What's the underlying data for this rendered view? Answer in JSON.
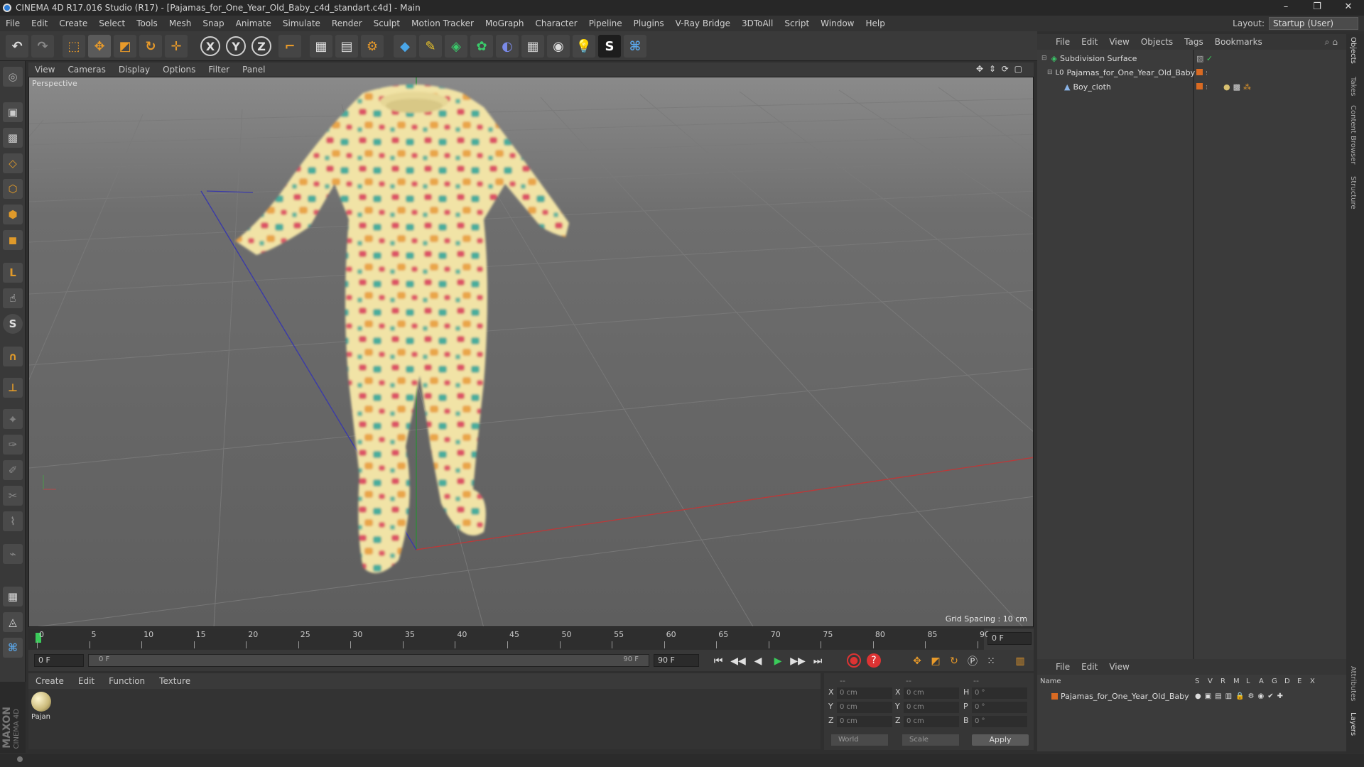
{
  "app": {
    "title": "CINEMA 4D R17.016 Studio (R17) - [Pajamas_for_One_Year_Old_Baby_c4d_standart.c4d] - Main",
    "window_controls": [
      "–",
      "❐",
      "✕"
    ]
  },
  "menubar": {
    "items": [
      "File",
      "Edit",
      "Create",
      "Select",
      "Tools",
      "Mesh",
      "Snap",
      "Animate",
      "Simulate",
      "Render",
      "Sculpt",
      "Motion Tracker",
      "MoGraph",
      "Character",
      "Pipeline",
      "Plugins",
      "V-Ray Bridge",
      "3DToAll",
      "Script",
      "Window",
      "Help"
    ],
    "layout_label": "Layout:",
    "layout_value": "Startup (User)"
  },
  "toolbar": {
    "x_label": "X",
    "y_label": "Y",
    "z_label": "Z"
  },
  "viewport": {
    "menu": [
      "View",
      "Cameras",
      "Display",
      "Options",
      "Filter",
      "Panel"
    ],
    "nav_icons": "✥ ⇕ ⟳ ▢",
    "camera_label": "Perspective",
    "grid_spacing": "Grid Spacing : 10 cm",
    "colors": {
      "pajama_base": "#f1e3a6",
      "print_red": "#d93a5a",
      "print_teal": "#2aa39a",
      "print_orange": "#e89a3a",
      "axis_x": "#b83a3a",
      "axis_y": "#2f8a3a",
      "axis_z": "#3a3aa8"
    }
  },
  "timeline": {
    "ticks": [
      "0",
      "5",
      "10",
      "15",
      "20",
      "25",
      "30",
      "35",
      "40",
      "45",
      "50",
      "55",
      "60",
      "65",
      "70",
      "75",
      "80",
      "85",
      "90"
    ],
    "current_frame": "0 F"
  },
  "controls": {
    "start_frame": "0 F",
    "range_start": "0 F",
    "range_end": "90 F",
    "end_frame": "90 F",
    "play_icons": [
      "⏮",
      "◀◀",
      "◀",
      "▶",
      "▶▶",
      "⏭"
    ]
  },
  "material_manager": {
    "menu": [
      "Create",
      "Edit",
      "Function",
      "Texture"
    ],
    "material_name": "Pajan"
  },
  "coordinates": {
    "header": [
      "--",
      "--",
      "--"
    ],
    "rows": [
      {
        "axis": "X",
        "pos": "0 cm",
        "size_axis": "X",
        "size": "0 cm",
        "rot_axis": "H",
        "rot": "0 °"
      },
      {
        "axis": "Y",
        "pos": "0 cm",
        "size_axis": "Y",
        "size": "0 cm",
        "rot_axis": "P",
        "rot": "0 °"
      },
      {
        "axis": "Z",
        "pos": "0 cm",
        "size_axis": "Z",
        "size": "0 cm",
        "rot_axis": "B",
        "rot": "0 °"
      }
    ],
    "mode_world": "World",
    "mode_scale": "Scale",
    "apply_label": "Apply"
  },
  "object_manager": {
    "menu": [
      "File",
      "Edit",
      "View",
      "Objects",
      "Tags",
      "Bookmarks"
    ],
    "objects": [
      {
        "name": "Subdivision Surface",
        "indent": 0
      },
      {
        "name": "Pajamas_for_One_Year_Old_Baby",
        "indent": 1
      },
      {
        "name": "Boy_cloth",
        "indent": 2
      }
    ]
  },
  "layer_manager": {
    "menu": [
      "File",
      "Edit",
      "View"
    ],
    "columns": [
      "Name",
      "S",
      "V",
      "R",
      "M",
      "L",
      "A",
      "G",
      "D",
      "E",
      "X"
    ],
    "layers": [
      {
        "name": "Pajamas_for_One_Year_Old_Baby"
      }
    ]
  },
  "side_tabs": [
    "Objects",
    "Takes",
    "Content Browser",
    "Structure",
    "Attributes",
    "Layers"
  ],
  "brand": {
    "maxon": "MAXON",
    "c4d": "CINEMA 4D"
  }
}
